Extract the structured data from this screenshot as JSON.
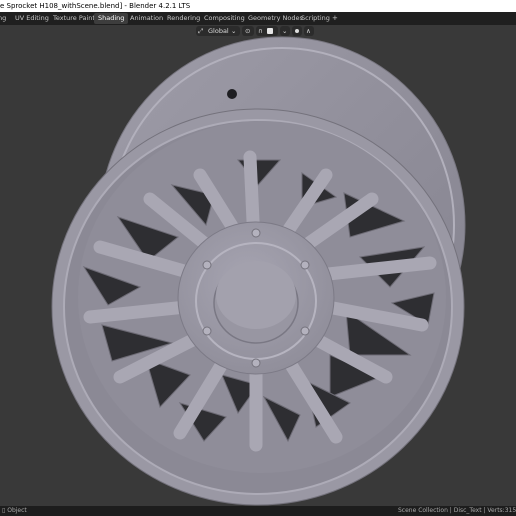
{
  "window": {
    "title": "e Sprocket H108_withScene.blend] - Blender 4.2.1 LTS"
  },
  "workspace_tabs": [
    {
      "label": "ng"
    },
    {
      "label": "UV Editing"
    },
    {
      "label": "Texture Paint"
    },
    {
      "label": "Shading"
    },
    {
      "label": "Animation"
    },
    {
      "label": "Rendering"
    },
    {
      "label": "Compositing"
    },
    {
      "label": "Geometry Nodes"
    },
    {
      "label": "Scripting"
    }
  ],
  "active_tab": "Shading",
  "add_workspace_label": "+",
  "viewport_header": {
    "transform_orientation": "Global",
    "colors": {
      "viewport_bg": "#393939",
      "model": "#9c9aa6"
    }
  },
  "status_bar": {
    "mode": "Object",
    "info": "Scene Collection | Disc_Text | Verts:315,04"
  }
}
